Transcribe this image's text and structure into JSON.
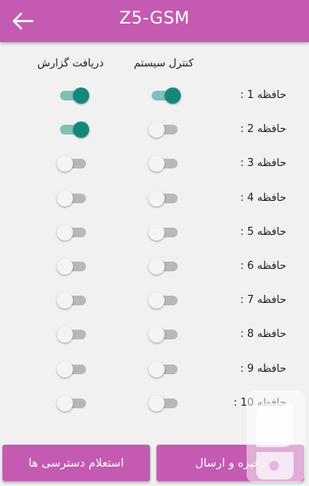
{
  "app_bar": {
    "title": "Z5-GSM",
    "back_icon": "arrow-left-icon",
    "color": "#c45ab1"
  },
  "columns": {
    "report": "دریافت گزارش",
    "control": "کنترل سیستم"
  },
  "rows": [
    {
      "label": "حافظه 1 :",
      "report": true,
      "control": true
    },
    {
      "label": "حافظه 2 :",
      "report": true,
      "control": false
    },
    {
      "label": "حافظه 3 :",
      "report": false,
      "control": false
    },
    {
      "label": "حافظه 4 :",
      "report": false,
      "control": false
    },
    {
      "label": "حافظه 5 :",
      "report": false,
      "control": false
    },
    {
      "label": "حافظه 6 :",
      "report": false,
      "control": false
    },
    {
      "label": "حافظه 7 :",
      "report": false,
      "control": false
    },
    {
      "label": "حافظه 8 :",
      "report": false,
      "control": false
    },
    {
      "label": "حافظه 9 :",
      "report": false,
      "control": false
    },
    {
      "label": "حافظه 10 :",
      "report": false,
      "control": false
    }
  ],
  "buttons": {
    "inquiry": "استعلام دسترسی ها",
    "save_send": "ذخیره و ارسال"
  },
  "colors": {
    "switch_on": "#13897a",
    "switch_off": "#b8b8b8"
  }
}
